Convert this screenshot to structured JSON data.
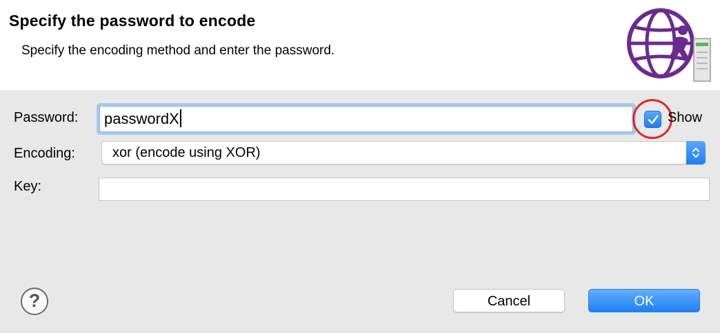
{
  "header": {
    "title": "Specify the password to encode",
    "description": "Specify the encoding method and enter the password."
  },
  "form": {
    "password_label": "Password:",
    "password_value": "passwordX",
    "show_label": "Show",
    "show_checked": true,
    "encoding_label": "Encoding:",
    "encoding_value": "xor (encode using XOR)",
    "key_label": "Key:",
    "key_value": ""
  },
  "footer": {
    "help_glyph": "?",
    "cancel_label": "Cancel",
    "ok_label": "OK"
  },
  "colors": {
    "accent": "#1a7ef2",
    "highlight_ring": "#e0242d",
    "logo_purple": "#6b2a8f"
  },
  "icons": [
    "globe-logo-icon",
    "checkmark-icon",
    "up-down-arrows-icon",
    "help-icon"
  ]
}
